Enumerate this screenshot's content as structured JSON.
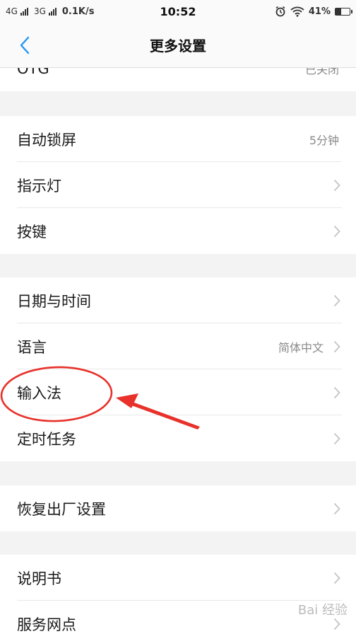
{
  "status_bar": {
    "network1": "4G",
    "network2": "3G",
    "speed": "0.1K/s",
    "time": "10:52",
    "battery": "41%",
    "battery_level": 0.41
  },
  "header": {
    "title": "更多设置"
  },
  "settings": [
    {
      "label": "OTG",
      "value": "已关闭",
      "chevron": false
    },
    {
      "label": "自动锁屏",
      "value": "5分钟",
      "chevron": false
    },
    {
      "label": "指示灯",
      "value": "",
      "chevron": true
    },
    {
      "label": "按键",
      "value": "",
      "chevron": true
    },
    {
      "label": "日期与时间",
      "value": "",
      "chevron": true
    },
    {
      "label": "语言",
      "value": "简体中文",
      "chevron": true
    },
    {
      "label": "输入法",
      "value": "",
      "chevron": true
    },
    {
      "label": "定时任务",
      "value": "",
      "chevron": true
    },
    {
      "label": "恢复出厂设置",
      "value": "",
      "chevron": true
    },
    {
      "label": "说明书",
      "value": "",
      "chevron": true
    },
    {
      "label": "服务网点",
      "value": "",
      "chevron": true
    }
  ],
  "annotation": {
    "color": "#e8312a"
  },
  "watermark": "Bai 经验",
  "colors": {
    "accent": "#2196f3",
    "annotation": "#e8312a"
  }
}
